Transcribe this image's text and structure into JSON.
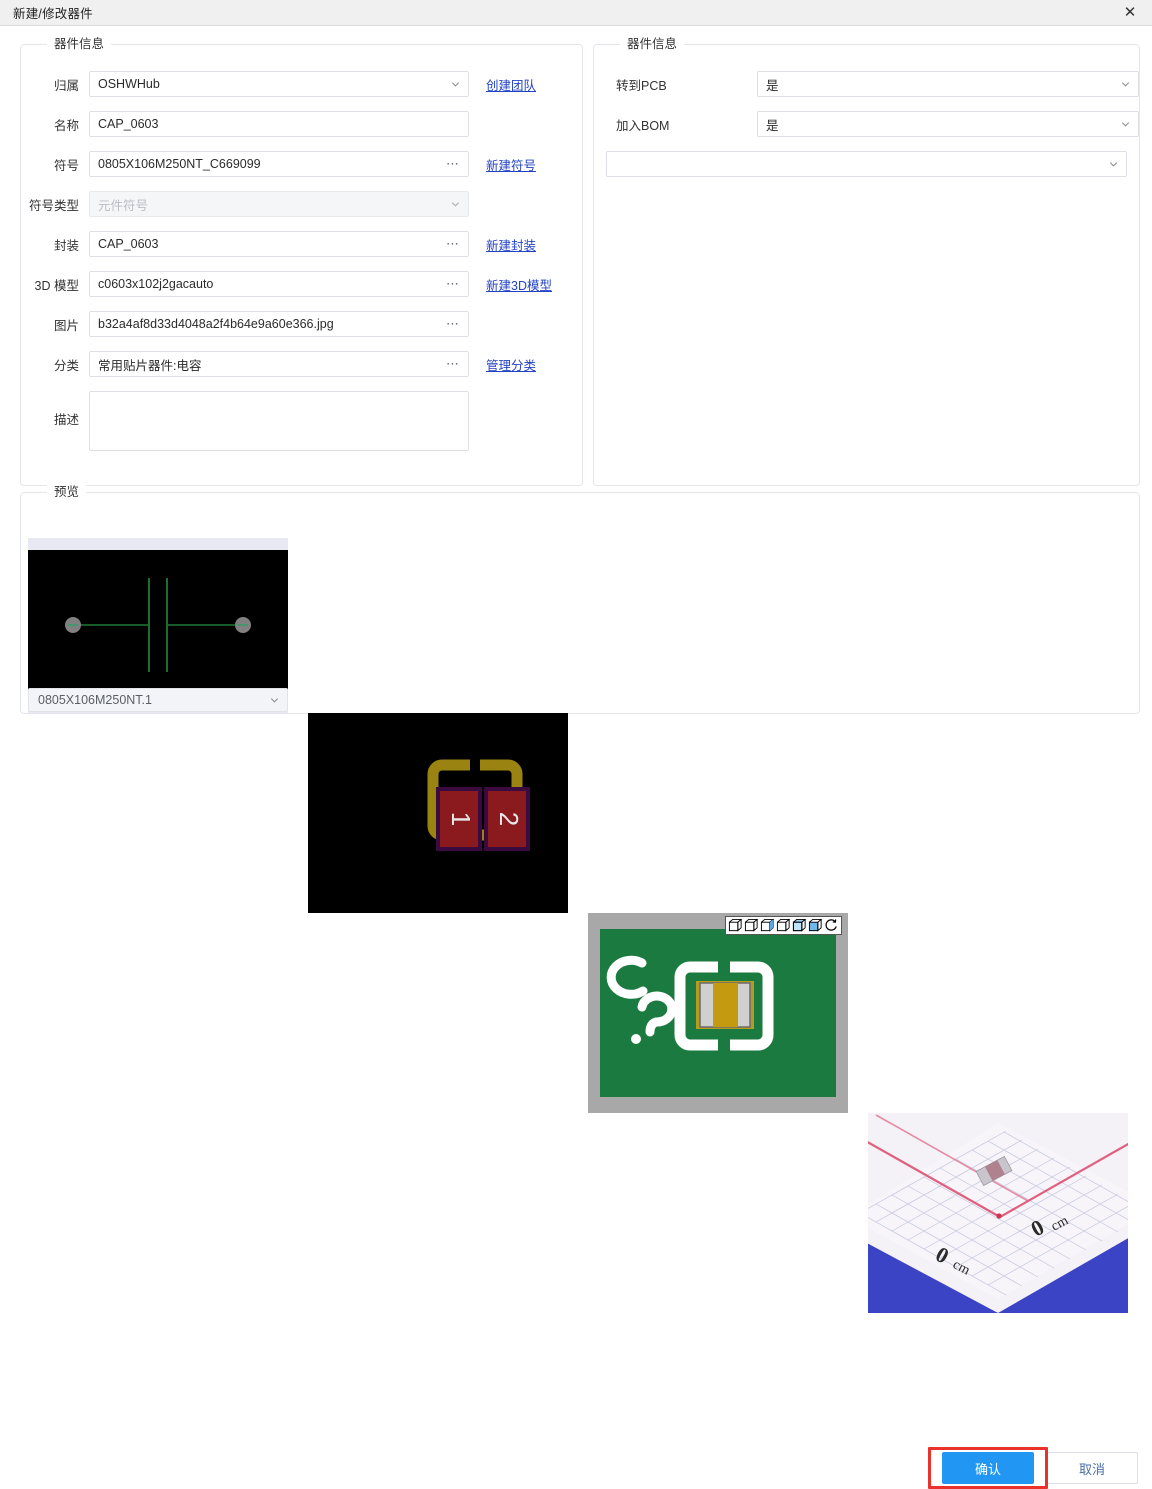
{
  "window": {
    "title": "新建/修改器件",
    "close_icon": "close-icon"
  },
  "left_panel": {
    "legend": "器件信息",
    "fields": [
      {
        "label": "归属",
        "value": "OSHWHub",
        "type": "select",
        "link": "创建团队"
      },
      {
        "label": "名称",
        "value": "CAP_0603",
        "type": "text",
        "link": ""
      },
      {
        "label": "符号",
        "value": "0805X106M250NT_C669099",
        "type": "browse",
        "link": "新建符号"
      },
      {
        "label": "符号类型",
        "value": "元件符号",
        "type": "select-disabled",
        "link": ""
      },
      {
        "label": "封装",
        "value": "CAP_0603",
        "type": "browse",
        "link": "新建封装"
      },
      {
        "label": "3D 模型",
        "value": "c0603x102j2gacauto",
        "type": "browse",
        "link": "新建3D模型"
      },
      {
        "label": "图片",
        "value": "b32a4af8d33d4048a2f4b64e9a60e366.jpg",
        "type": "browse",
        "link": ""
      },
      {
        "label": "分类",
        "value": "常用贴片器件:电容",
        "type": "browse",
        "link": "管理分类"
      },
      {
        "label": "描述",
        "value": "",
        "type": "textarea",
        "link": ""
      }
    ]
  },
  "right_panel": {
    "legend": "器件信息",
    "fields": [
      {
        "label": "转到PCB",
        "value": "是",
        "type": "select"
      },
      {
        "label": "加入BOM",
        "value": "是",
        "type": "select"
      },
      {
        "label": "",
        "value": "",
        "type": "select"
      }
    ]
  },
  "preview": {
    "legend": "预览",
    "symbol_select_value": "0805X106M250NT.1",
    "items": [
      {
        "name": "symbol-preview",
        "kind": "schematic-symbol"
      },
      {
        "name": "footprint-preview",
        "kind": "pcb-footprint",
        "pad_labels": [
          "1",
          "2"
        ]
      },
      {
        "name": "model3d-preview",
        "kind": "3d-model",
        "toolbar_icons": [
          "view-cube-1-icon",
          "view-cube-2-icon",
          "view-cube-3-icon",
          "view-cube-4-icon",
          "view-cube-5-icon",
          "view-cube-6-icon",
          "rotate-icon"
        ]
      },
      {
        "name": "photo-preview",
        "kind": "product-photo",
        "scale_labels": [
          "0 cm",
          "0 cm"
        ]
      }
    ]
  },
  "footer": {
    "confirm_label": "确认",
    "cancel_label": "取消"
  },
  "colors": {
    "accent": "#2196f3",
    "link": "#2343c4",
    "highlight": "#e8322b",
    "titlebar": "#f0f0f0",
    "border": "#dcdfe6"
  }
}
